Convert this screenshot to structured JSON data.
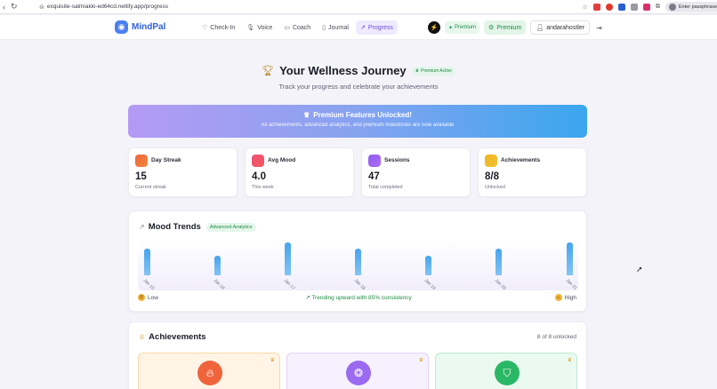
{
  "browser": {
    "url": "exquisite-salmiakki-ed64cd.netlify.app/progress",
    "profile_text": "Enter passphrase"
  },
  "nav": {
    "brand": "MindPal",
    "links": [
      {
        "label": "Check-In",
        "icon": "heart-icon",
        "active": false
      },
      {
        "label": "Voice",
        "icon": "microphone-icon",
        "active": false
      },
      {
        "label": "Coach",
        "icon": "video-icon",
        "active": false
      },
      {
        "label": "Journal",
        "icon": "book-icon",
        "active": false
      },
      {
        "label": "Progress",
        "icon": "trend-icon",
        "active": true
      }
    ],
    "premium_pill": "Premium",
    "premium_button": "Premium",
    "username": "andarahostler"
  },
  "header": {
    "title": "Your Wellness Journey",
    "badge": "Premium Active",
    "subtitle": "Track your progress and celebrate your achievements"
  },
  "banner": {
    "title": "Premium Features Unlocked!",
    "description": "All achievements, advanced analytics, and premium milestones are now available"
  },
  "stats": [
    {
      "label": "Day Streak",
      "value": "15",
      "sub": "Current streak",
      "color": "#f0643c"
    },
    {
      "label": "Avg Mood",
      "value": "4.0",
      "sub": "This week",
      "color": "#f0507a"
    },
    {
      "label": "Sessions",
      "value": "47",
      "sub": "Total completed",
      "color": "#8c5cf0"
    },
    {
      "label": "Achievements",
      "value": "8/8",
      "sub": "Unlocked",
      "color": "#f0b21a"
    }
  ],
  "mood": {
    "title": "Mood Trends",
    "badge": "Advanced Analytics",
    "low_label": "Low",
    "high_label": "High",
    "trend_text": "Trending upward with 85% consistency"
  },
  "chart_data": {
    "type": "bar",
    "categories": [
      "Jan 15",
      "Jan 16",
      "Jan 17",
      "Jan 18",
      "Jan 19",
      "Jan 20",
      "Jan 21"
    ],
    "values": [
      4,
      3,
      5,
      4,
      3,
      4,
      5
    ],
    "ylim": [
      0,
      5
    ],
    "bar_color": "#46a4ee"
  },
  "achievements": {
    "title": "Achievements",
    "count": "8 of 8 unlocked",
    "cards": [
      {
        "icon": "flame-icon",
        "bg": "#fff4e6",
        "border": "#f8d9a8",
        "circle": "#f0643c"
      },
      {
        "icon": "brain-icon",
        "bg": "#f7f1ff",
        "border": "#e2d3f8",
        "circle": "#9a6bf0"
      },
      {
        "icon": "shield-icon",
        "bg": "#eafaf0",
        "border": "#bfe9cf",
        "circle": "#2bb866"
      }
    ]
  }
}
